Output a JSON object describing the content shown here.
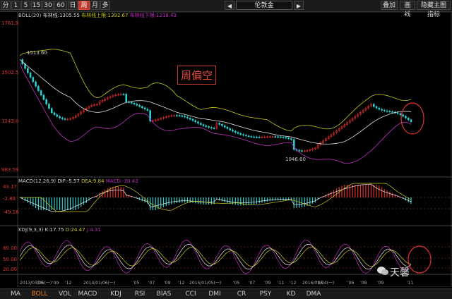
{
  "topbar": {
    "periods": [
      "分",
      "1",
      "5",
      "15",
      "30",
      "60",
      "日",
      "周",
      "月",
      "多"
    ],
    "active_period": "周",
    "symbol": "伦敦金",
    "nav_left": "◀",
    "nav_right": "▶",
    "right_buttons": [
      "叠加",
      "画线",
      "隐藏主图指标"
    ]
  },
  "boll_panel": {
    "title": "BOLL(20)",
    "mid_label": "布林线:1305.55",
    "upper_label": "布林线上限:1392.67",
    "lower_label": "布林线下限:1218.43",
    "y_labels": [
      "1761.9",
      "1502.5",
      "1243.0",
      "983.59"
    ],
    "high_marker": "1513.60",
    "low_marker": "1046.60",
    "annotation": "周偏空"
  },
  "macd_panel": {
    "title": "MACD(12,26,9)",
    "dif_label": "DIF:-5.57",
    "dea_label": "DEA:9.84",
    "macd_label": "MACD:-30.43",
    "y_labels": [
      "43.17",
      "-2.88",
      "-49.16"
    ]
  },
  "kdj_panel": {
    "title": "KDJ(9,3,3)",
    "k_label": "K:17.75",
    "d_label": "D:24.47",
    "j_label": "J:4.31",
    "y_labels": [
      "80.00",
      "50.00",
      "20.00"
    ]
  },
  "x_axis": [
    "2013/03/25(一)",
    "'06",
    "'09",
    "'12",
    "2014/01/06(一)",
    "'05",
    "'07",
    "'09",
    "'12",
    "2015/01/05(一)",
    "'05",
    "'07",
    "'09",
    "'11",
    "'12",
    "2016/01/04(一)",
    "'05",
    "'06",
    "'08",
    "'09",
    "'11"
  ],
  "tabs": [
    "MA",
    "BOLL",
    "VOL",
    "MACD",
    "KDJ",
    "RSI",
    "BIAS",
    "CCI",
    "DMI",
    "CR",
    "PSY",
    "KD",
    "DMA"
  ],
  "active_tab": "BOLL",
  "watermark": "天馨",
  "colors": {
    "up": "#e03030",
    "down": "#30d0d0",
    "boll_upper": "#c8c820",
    "boll_mid": "#e0e0e0",
    "boll_lower": "#c030c0",
    "circle": "#e03030"
  }
}
